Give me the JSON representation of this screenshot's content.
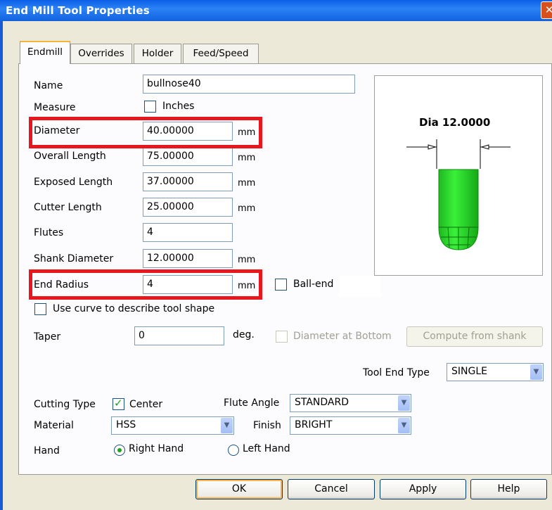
{
  "window": {
    "title": "End Mill Tool Properties",
    "close_symbol": "✕"
  },
  "tabs": [
    {
      "label": "Endmill",
      "active": true
    },
    {
      "label": "Overrides",
      "active": false
    },
    {
      "label": "Holder",
      "active": false
    },
    {
      "label": "Feed/Speed",
      "active": false
    }
  ],
  "form": {
    "name_label": "Name",
    "name_value": "bullnose40",
    "measure_label": "Measure",
    "inches_label": "Inches",
    "inches_checked": false,
    "diameter_label": "Diameter",
    "diameter_value": "40.00000",
    "diameter_unit": "mm",
    "overall_length_label": "Overall Length",
    "overall_length_value": "75.00000",
    "overall_length_unit": "mm",
    "exposed_length_label": "Exposed Length",
    "exposed_length_value": "37.00000",
    "exposed_length_unit": "mm",
    "cutter_length_label": "Cutter Length",
    "cutter_length_value": "25.00000",
    "cutter_length_unit": "mm",
    "flutes_label": "Flutes",
    "flutes_value": "4",
    "shank_diameter_label": "Shank Diameter",
    "shank_diameter_value": "12.00000",
    "shank_diameter_unit": "mm",
    "end_radius_label": "End Radius",
    "end_radius_value": "4",
    "end_radius_unit": "mm",
    "ball_end_label": "Ball-end",
    "ball_end_checked": false,
    "use_curve_label": "Use curve to describe tool shape",
    "use_curve_checked": false,
    "taper_label": "Taper",
    "taper_value": "0",
    "taper_unit": "deg.",
    "diameter_at_bottom_label": "Diameter at Bottom",
    "compute_from_shank_label": "Compute from shank",
    "tool_end_type_label": "Tool End Type",
    "tool_end_type_value": "SINGLE",
    "cutting_type_label": "Cutting Type",
    "center_label": "Center",
    "center_checked": true,
    "flute_angle_label": "Flute Angle",
    "flute_angle_value": "STANDARD",
    "material_label": "Material",
    "material_value": "HSS",
    "finish_label": "Finish",
    "finish_value": "BRIGHT",
    "hand_label": "Hand",
    "right_hand_label": "Right Hand",
    "left_hand_label": "Left Hand",
    "hand_selected": "Right Hand"
  },
  "preview": {
    "dimension_label": "Dia 12.0000",
    "tool_color": "#2EDB2E"
  },
  "buttons": {
    "ok": "OK",
    "cancel": "Cancel",
    "apply": "Apply",
    "help": "Help"
  },
  "colors": {
    "highlight_box": "#E8161D",
    "title_bar": "#1262DE",
    "dialog_bg": "#ECE9D8"
  }
}
